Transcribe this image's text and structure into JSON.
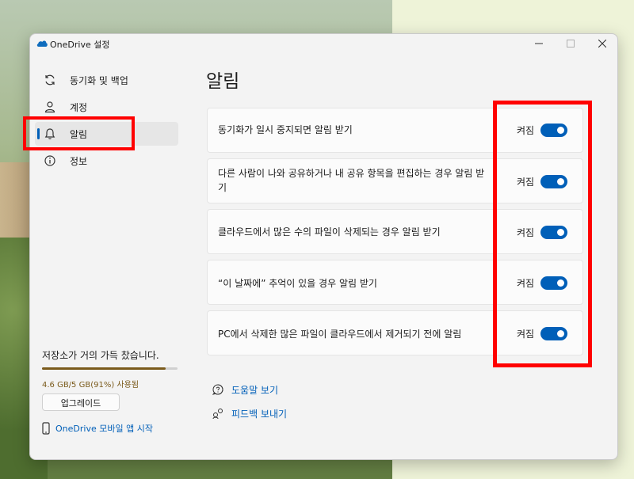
{
  "window": {
    "title": "OneDrive 설정"
  },
  "sidebar": {
    "items": [
      {
        "label": "동기화 및 백업",
        "icon": "sync-icon"
      },
      {
        "label": "계정",
        "icon": "person-icon"
      },
      {
        "label": "알림",
        "icon": "bell-icon",
        "selected": true
      },
      {
        "label": "정보",
        "icon": "info-icon"
      }
    ],
    "storage": {
      "message": "저장소가 거의 가득 찼습니다.",
      "usage": "4.6 GB/5 GB(91%) 사용됨",
      "used_fraction": 0.91
    },
    "upgrade_label": "업그레이드",
    "mobile_link_label": "OneDrive 모바일 앱 시작"
  },
  "main": {
    "title": "알림",
    "settings": [
      {
        "text": "동기화가 일시 중지되면 알림 받기",
        "state_label": "켜짐",
        "on": true
      },
      {
        "text": "다른 사람이 나와 공유하거나 내 공유 항목을 편집하는 경우 알림 받기",
        "state_label": "켜짐",
        "on": true
      },
      {
        "text": "클라우드에서 많은 수의 파일이 삭제되는 경우 알림 받기",
        "state_label": "켜짐",
        "on": true
      },
      {
        "text": "“이 날짜에” 추억이 있을 경우 알림 받기",
        "state_label": "켜짐",
        "on": true
      },
      {
        "text": "PC에서 삭제한 많은 파일이 클라우드에서 제거되기 전에 알림",
        "state_label": "켜짐",
        "on": true
      }
    ],
    "links": {
      "help": "도움말 보기",
      "feedback": "피드백 보내기"
    }
  },
  "colors": {
    "accent": "#005fb8",
    "highlight": "#ff0000",
    "storage_warning": "#7a5a1b"
  }
}
